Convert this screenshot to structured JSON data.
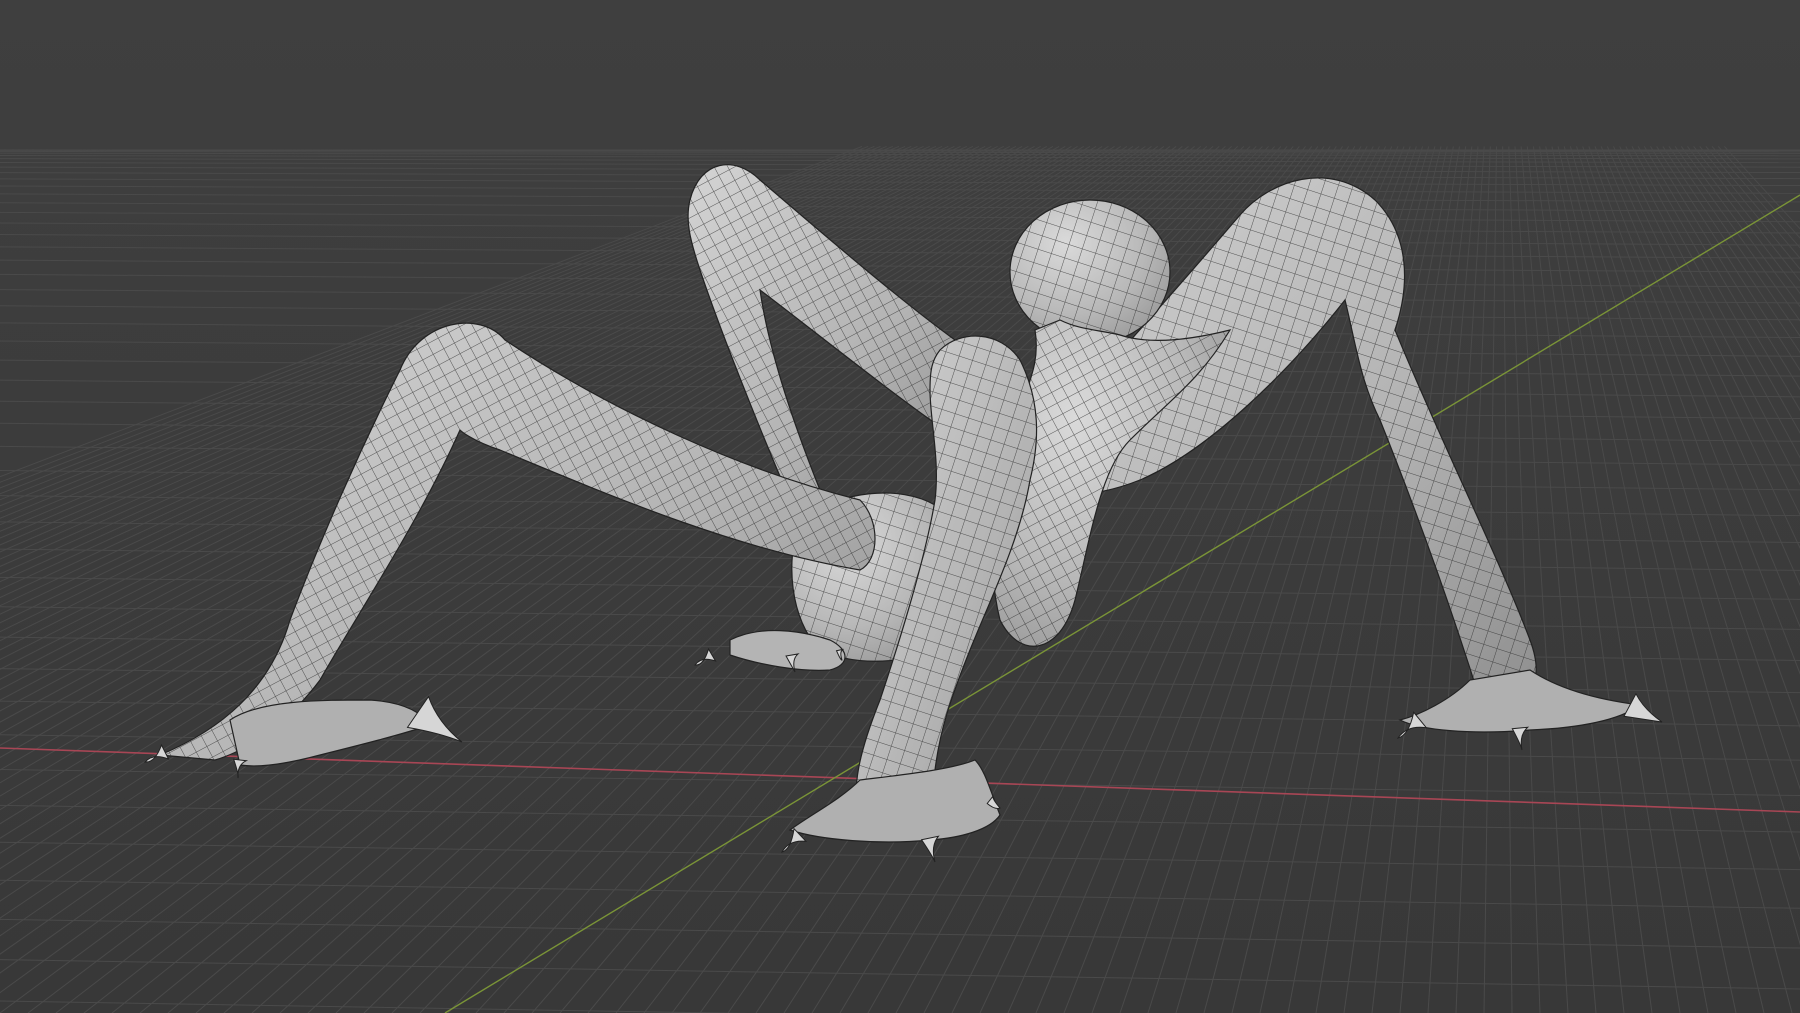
{
  "app": {
    "view": "3d-viewport",
    "shading": "solid-wireframe-overlay",
    "object": "creature-mesh"
  },
  "colors": {
    "background": "#3d3d3d",
    "grid_line": "#4a4a4a",
    "x_axis": "#b04a57",
    "y_axis": "#7e9a3a",
    "mesh_fill": "#bcbcbc",
    "mesh_shadow": "#8a8a8a",
    "wire": "#1e1e1e",
    "claw": "#d6d6d6"
  },
  "mesh": {
    "parts": [
      "head",
      "neck",
      "torso",
      "pelvis",
      "front-left-leg",
      "front-right-leg",
      "rear-left-leg",
      "rear-right-leg",
      "claws"
    ]
  }
}
